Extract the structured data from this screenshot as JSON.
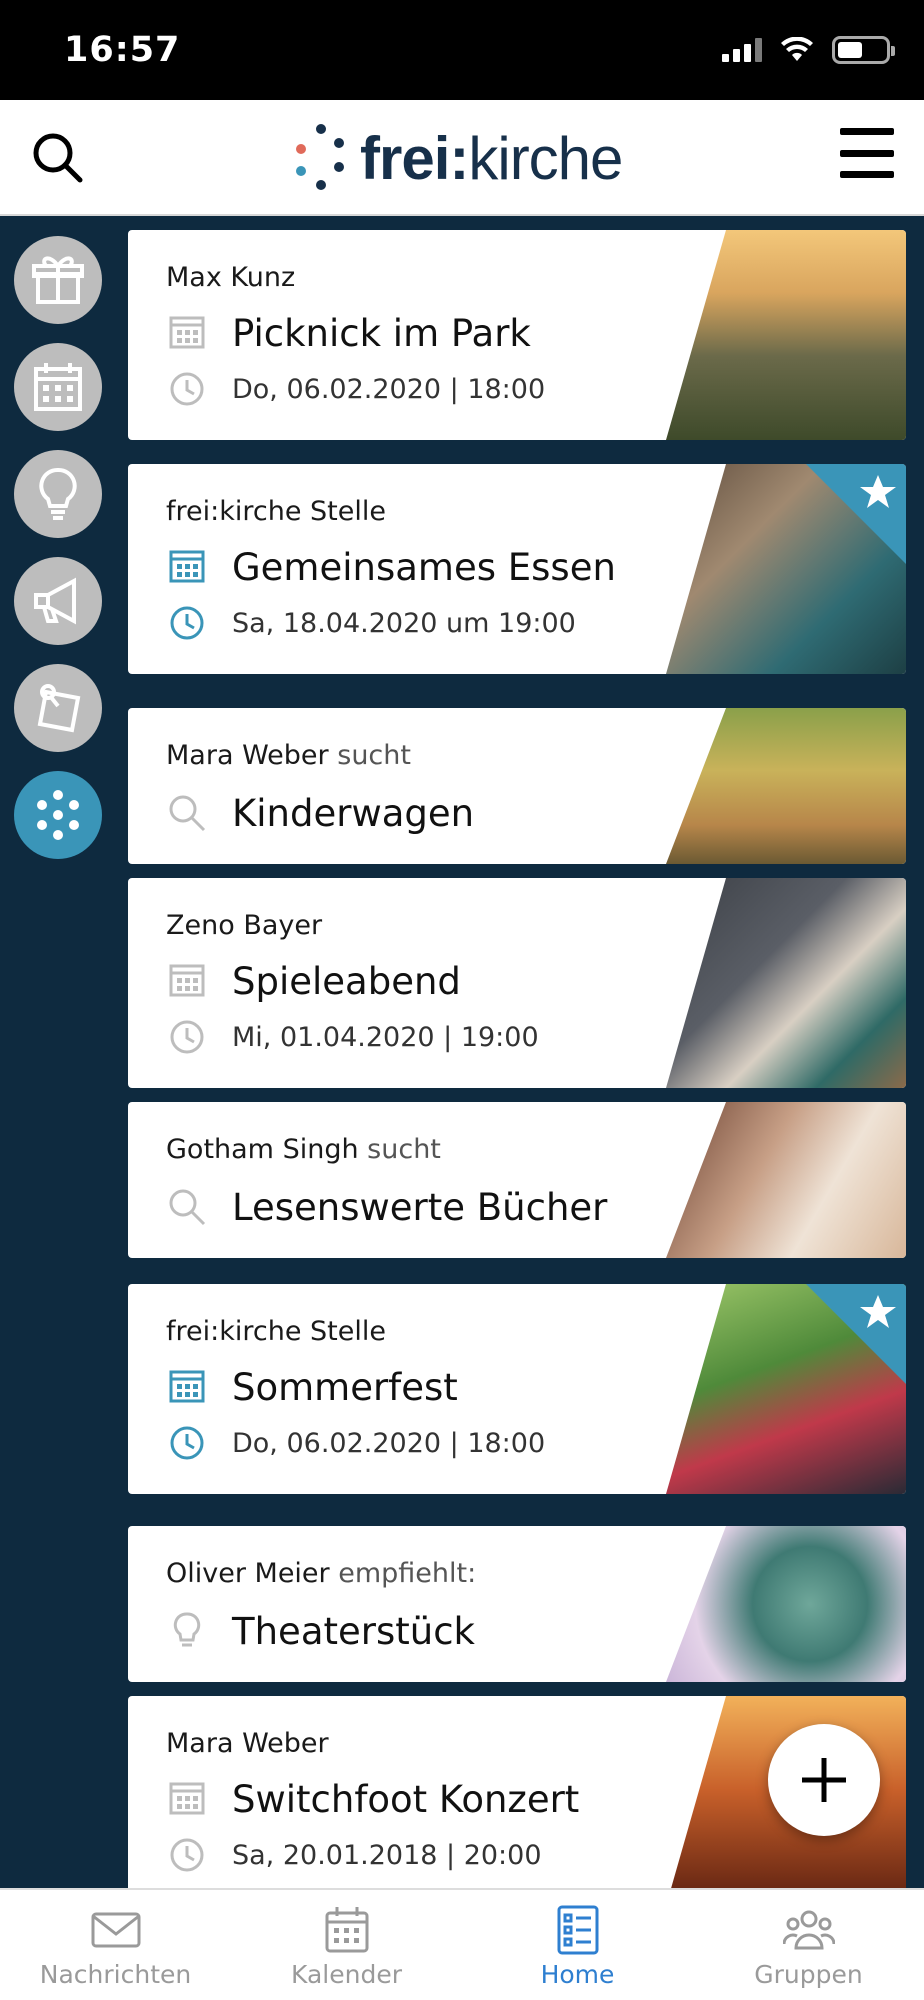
{
  "status_bar": {
    "time": "16:57"
  },
  "header": {
    "logo_bold": "frei:",
    "logo_rest": "kirche",
    "search_icon": "search-icon",
    "menu_icon": "hamburger-menu-icon"
  },
  "side_rail": {
    "items": [
      {
        "icon": "gift-icon"
      },
      {
        "icon": "calendar-icon"
      },
      {
        "icon": "lightbulb-icon"
      },
      {
        "icon": "megaphone-icon"
      },
      {
        "icon": "note-pin-icon"
      },
      {
        "icon": "dots-circle-icon",
        "active": true
      }
    ]
  },
  "feed": {
    "cards": [
      {
        "author": "Max Kunz",
        "verb": "",
        "title": "Picknick im Park",
        "date": "Do, 06.02.2020 | 18:00",
        "kind": "event",
        "featured": false
      },
      {
        "author": "frei:kirche Stelle",
        "verb": "",
        "title": "Gemeinsames Essen",
        "date": "Sa, 18.04.2020 um 19:00",
        "kind": "event",
        "featured": true
      },
      {
        "author": "Mara Weber",
        "verb": "sucht",
        "title": "Kinderwagen",
        "date": "",
        "kind": "search",
        "featured": false
      },
      {
        "author": "Zeno Bayer",
        "verb": "",
        "title": "Spieleabend",
        "date": "Mi, 01.04.2020 | 19:00",
        "kind": "event",
        "featured": false
      },
      {
        "author": "Gotham Singh",
        "verb": "sucht",
        "title": "Lesenswerte Bücher",
        "date": "",
        "kind": "search",
        "featured": false
      },
      {
        "author": "frei:kirche Stelle",
        "verb": "",
        "title": "Sommerfest",
        "date": "Do, 06.02.2020 | 18:00",
        "kind": "event",
        "featured": true
      },
      {
        "author": "Oliver Meier",
        "verb": "empfiehlt:",
        "title": "Theaterstück",
        "date": "",
        "kind": "tip",
        "featured": false
      },
      {
        "author": "Mara Weber",
        "verb": "",
        "title": "Switchfoot Konzert",
        "date": "Sa, 20.01.2018 | 20:00",
        "kind": "event",
        "featured": false
      }
    ]
  },
  "fab": {
    "icon": "plus-icon"
  },
  "bottom_nav": {
    "items": [
      {
        "label": "Nachrichten",
        "icon": "mail-icon",
        "active": false
      },
      {
        "label": "Kalender",
        "icon": "calendar-icon",
        "active": false
      },
      {
        "label": "Home",
        "icon": "list-icon",
        "active": true
      },
      {
        "label": "Gruppen",
        "icon": "group-icon",
        "active": false
      }
    ]
  },
  "colors": {
    "accent": "#3a95b8",
    "background": "#0e2a3f",
    "nav_active": "#2e7fd0",
    "icon_gray": "#bdbdbd"
  }
}
